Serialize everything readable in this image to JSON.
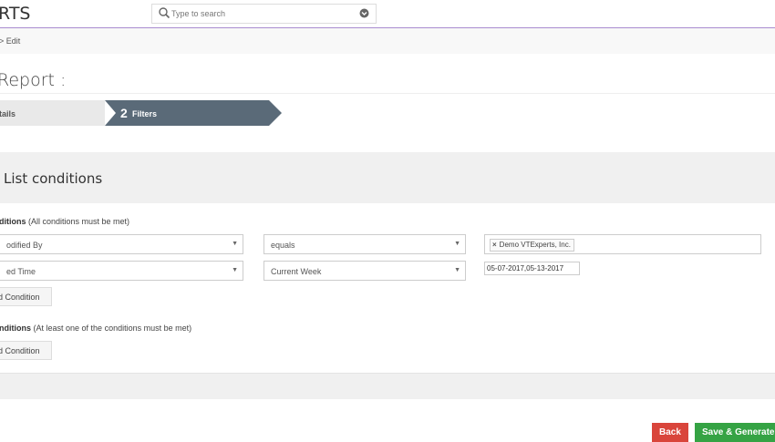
{
  "header": {
    "brand": "RTS",
    "search_placeholder": "Type to search"
  },
  "breadcrumb": "> Edit",
  "page_title": "Report :",
  "steps": [
    {
      "label": "tails"
    },
    {
      "number": "2",
      "label": "Filters"
    }
  ],
  "panel": {
    "title": "List conditions",
    "all_conditions": {
      "label": "ditions",
      "note": "(All conditions must be met)",
      "rows": [
        {
          "field": "odified By",
          "operator": "equals",
          "value_tag": "Demo VTExperts, Inc."
        },
        {
          "field": "ed Time",
          "operator": "Current Week",
          "value_text": "05-07-2017,05-13-2017"
        }
      ],
      "add_label": "d Condition"
    },
    "any_conditions": {
      "label": "nditions",
      "note": "(At least one of the conditions must be met)",
      "add_label": "d Condition"
    }
  },
  "footer": {
    "back_label": "Back",
    "save_label": "Save & Generate"
  },
  "colors": {
    "accent_line": "#a98bd0",
    "step_active": "#5a6a78",
    "back": "#d9453b",
    "save": "#35a344"
  }
}
